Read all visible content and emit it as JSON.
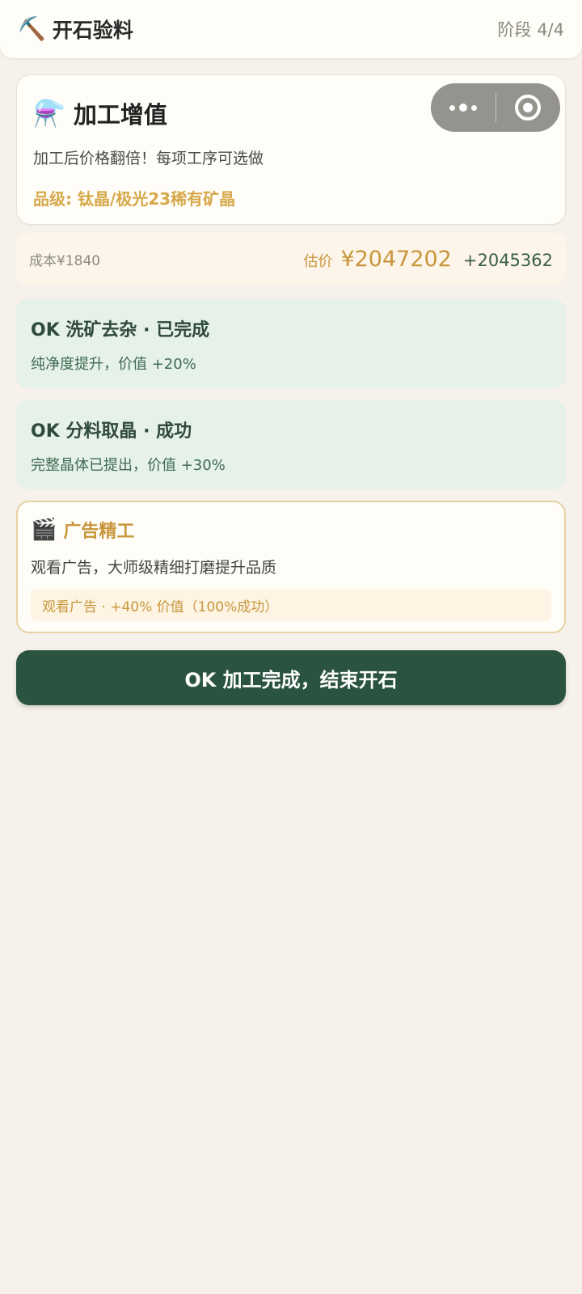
{
  "topbar": {
    "app_icon": "⛏️",
    "title": "开石验料",
    "stage": "阶段 4/4"
  },
  "header": {
    "icon": "⚗️",
    "title": "加工增值",
    "description": "加工后价格翻倍！每项工序可选做",
    "grade": "品级: 钛晶/极光23稀有矿晶"
  },
  "capsule": {
    "more_icon": "more-dots-icon",
    "close_icon": "target-close-icon"
  },
  "price": {
    "cost": "成本¥1840",
    "estimate_label": "估价",
    "estimate_value": "¥2047202",
    "gain": "+2045362"
  },
  "steps": [
    {
      "title": "OK 洗矿去杂 · 已完成",
      "description": "纯净度提升，价值 +20%"
    },
    {
      "title": "OK 分料取晶 · 成功",
      "description": "完整晶体已提出，价值 +30%"
    }
  ],
  "ad": {
    "icon": "🎬",
    "title": "广告精工",
    "description": "观看广告，大师级精细打磨提升品质",
    "button_label": "观看广告 · +40% 价值（100%成功）"
  },
  "finish_button": "OK 加工完成，结束开石",
  "colors": {
    "accent_gold": "#c8963c",
    "primary_green": "#2b5440",
    "step_bg": "#e5f1e9",
    "page_bg": "#f6f1ea"
  }
}
